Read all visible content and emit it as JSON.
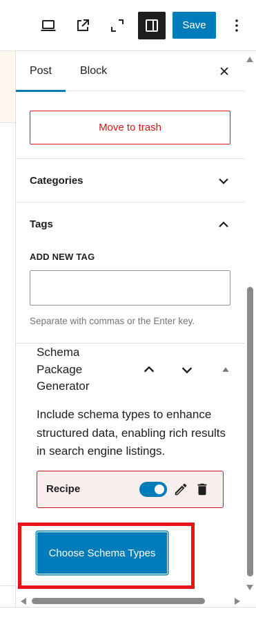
{
  "toolbar": {
    "icons": [
      "laptop-preview-icon",
      "external-view-icon",
      "fullscreen-icon",
      "sidebar-toggle-icon",
      "more-options-icon"
    ],
    "save_label": "Save",
    "accent": "#007cba"
  },
  "sidebar": {
    "tabs": [
      {
        "label": "Post",
        "active": true
      },
      {
        "label": "Block",
        "active": false
      }
    ],
    "move_to_trash_label": "Move to trash",
    "panels": {
      "categories": {
        "title": "Categories",
        "expanded": false
      },
      "tags": {
        "title": "Tags",
        "expanded": true,
        "add_new_label": "ADD NEW TAG",
        "input_value": "",
        "help_text": "Separate with commas or the Enter key."
      }
    },
    "schema_package": {
      "title": "Schema Package Generator",
      "description": "Include schema types to enhance structured data, enabling rich results in search engine listings.",
      "types": [
        {
          "name": "Recipe",
          "enabled": true
        }
      ],
      "choose_button_label": "Choose Schema Types",
      "highlight_color": "#e8141c"
    }
  }
}
